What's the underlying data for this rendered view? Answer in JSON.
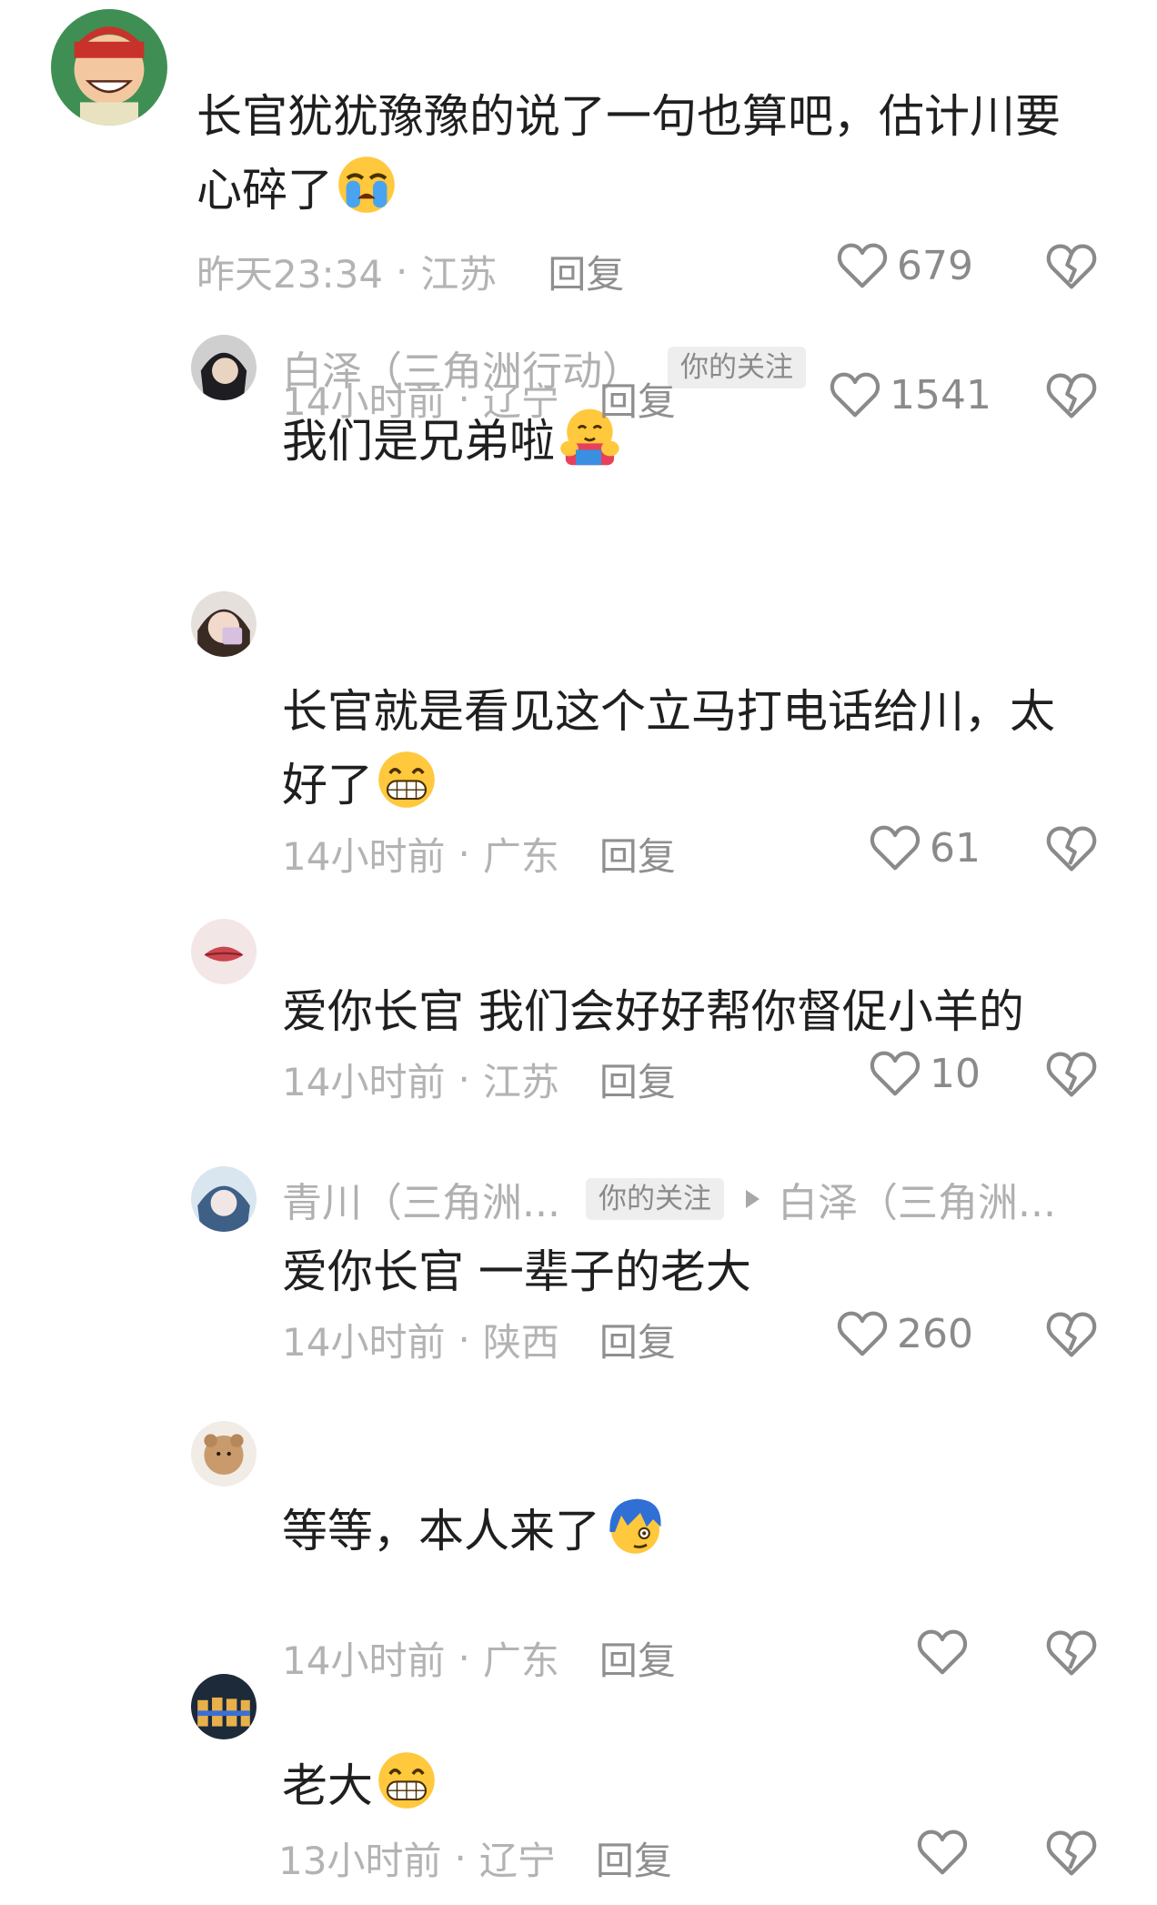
{
  "comments": [
    {
      "text_line1": "长官犹犹豫豫的说了一句也算吧，估计川要",
      "text_line2": "心碎了",
      "emoji": "crying-face-icon",
      "time": "昨天23:34",
      "location": "江苏",
      "reply_label": "回复",
      "likes": "679"
    },
    {
      "username": "白泽（三角洲行动）",
      "tag": "你的关注",
      "text_line1": "我们是兄弟啦",
      "emoji": "hugging-face-icon",
      "time": "14小时前",
      "location": "辽宁",
      "reply_label": "回复",
      "likes": "1541"
    },
    {
      "text_line1": "长官就是看见这个立马打电话给川，太",
      "text_line2": "好了",
      "emoji": "grinning-face-icon",
      "time": "14小时前",
      "location": "广东",
      "reply_label": "回复",
      "likes": "61"
    },
    {
      "text_line1": "爱你长官 我们会好好帮你督促小羊的",
      "time": "14小时前",
      "location": "江苏",
      "reply_label": "回复",
      "likes": "10"
    },
    {
      "username": "青川（三角洲...",
      "tag": "你的关注",
      "reply_to": "白泽（三角洲...",
      "text_line1": "爱你长官 一辈子的老大",
      "time": "14小时前",
      "location": "陕西",
      "reply_label": "回复",
      "likes": "260"
    },
    {
      "text_line1": "等等，本人来了",
      "emoji": "blue-hair-face-icon",
      "time": "14小时前",
      "location": "广东",
      "reply_label": "回复",
      "likes": ""
    },
    {
      "text_line1": "老大",
      "emoji": "grinning-face-icon",
      "time": "13小时前",
      "location": "辽宁",
      "reply_label": "回复",
      "likes": ""
    }
  ],
  "meta_separator": "·",
  "colors": {
    "meta_gray": "#b3b3b3",
    "text": "#1f1f1f",
    "icon_gray": "#8a8a8a",
    "emoji_yellow": "#ffc83d",
    "tear_blue": "#4aa3f0"
  }
}
